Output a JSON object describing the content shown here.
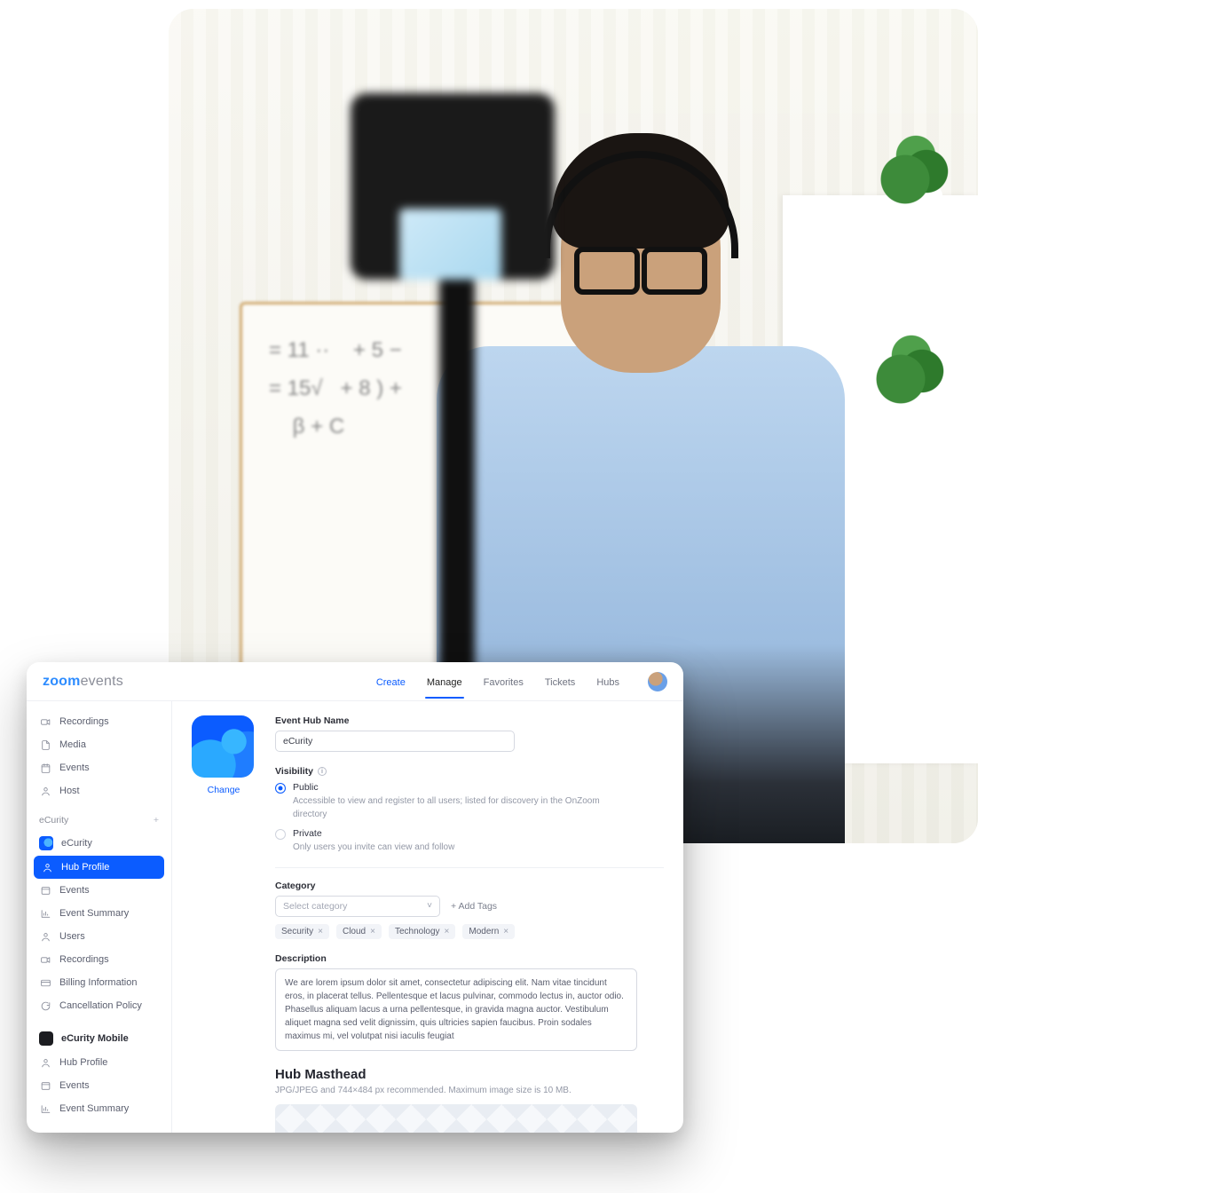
{
  "brand": {
    "part1": "zoom",
    "part2": "events"
  },
  "nav": {
    "create": "Create",
    "manage": "Manage",
    "favorites": "Favorites",
    "tickets": "Tickets",
    "hubs": "Hubs"
  },
  "sidebar": {
    "top": {
      "recordings": "Recordings",
      "media": "Media",
      "events": "Events",
      "host": "Host"
    },
    "section1_title": "eCurity",
    "items1": {
      "ecurity": "eCurity",
      "hub_profile": "Hub Profile",
      "events": "Events",
      "event_summary": "Event Summary",
      "users": "Users",
      "recordings": "Recordings",
      "billing": "Billing Information",
      "cancellation": "Cancellation Policy"
    },
    "section2_title": "eCurity Mobile",
    "items2": {
      "hub_profile": "Hub Profile",
      "events": "Events",
      "event_summary": "Event Summary"
    }
  },
  "hub_tile": {
    "change": "Change"
  },
  "form": {
    "name_label": "Event Hub Name",
    "name_value": "eCurity",
    "visibility_label": "Visibility",
    "public_label": "Public",
    "public_desc": "Accessible to view and register to all users; listed for discovery in the OnZoom directory",
    "private_label": "Private",
    "private_desc": "Only users you invite can view and follow",
    "category_label": "Category",
    "category_placeholder": "Select category",
    "add_tags": "+  Add Tags",
    "tags": {
      "t0": "Security",
      "t1": "Cloud",
      "t2": "Technology",
      "t3": "Modern"
    },
    "desc_label": "Description",
    "desc_value": "We are lorem ipsum dolor sit amet, consectetur adipiscing elit. Nam vitae tincidunt eros, in placerat tellus. Pellentesque et lacus pulvinar, commodo lectus in, auctor odio. Phasellus aliquam lacus a urna pellentesque, in gravida magna auctor. Vestibulum aliquet magna sed velit dignissim, quis ultricies sapien faucibus. Proin sodales maximus mi, vel volutpat nisi iaculis feugiat"
  },
  "masthead": {
    "title": "Hub Masthead",
    "sub": "JPG/JPEG and 744×484 px recommended. Maximum image size is 10 MB."
  }
}
